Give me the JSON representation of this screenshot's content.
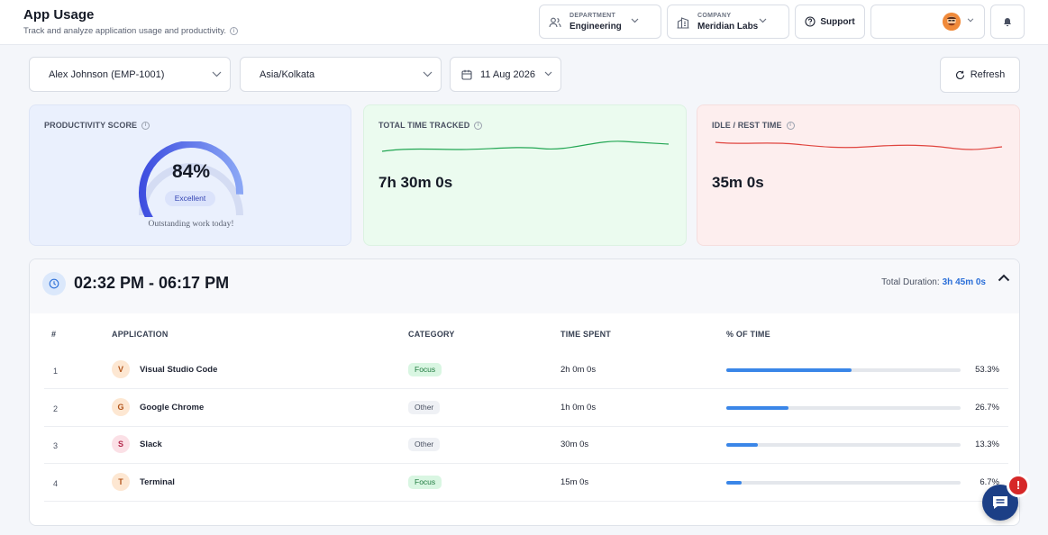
{
  "header": {
    "title": "App Usage",
    "subtitle": "Track and analyze application usage and productivity.",
    "department": {
      "label": "DEPARTMENT",
      "value": "Engineering"
    },
    "company": {
      "label": "COMPANY",
      "value": "Meridian Labs"
    },
    "support_label": "Support"
  },
  "filters": {
    "employee": "Alex Johnson (EMP-1001)",
    "timezone": "Asia/Kolkata",
    "date": "11 Aug 2026",
    "refresh_label": "Refresh"
  },
  "cards": {
    "productivity": {
      "title": "PRODUCTIVITY SCORE",
      "score_text": "84%",
      "score": 84,
      "badge": "Excellent",
      "note": "Outstanding work today!"
    },
    "tracked": {
      "title": "TOTAL TIME TRACKED",
      "value": "7h 30m 0s",
      "color": "#22a653"
    },
    "idle": {
      "title": "IDLE / REST TIME",
      "value": "35m 0s",
      "color": "#e0453f"
    }
  },
  "session": {
    "range": "02:32 PM - 06:17 PM",
    "duration_label": "Total Duration:",
    "duration_value": "3h 45m 0s",
    "columns": [
      "#",
      "APPLICATION",
      "CATEGORY",
      "TIME SPENT",
      "% OF TIME"
    ],
    "rows": [
      {
        "n": "1",
        "initial": "V",
        "name": "Visual Studio Code",
        "category": "Focus",
        "time": "2h 0m 0s",
        "pct_text": "53.3%",
        "pct": 53.3
      },
      {
        "n": "2",
        "initial": "G",
        "name": "Google Chrome",
        "category": "Other",
        "time": "1h 0m 0s",
        "pct_text": "26.7%",
        "pct": 26.7
      },
      {
        "n": "3",
        "initial": "S",
        "name": "Slack",
        "category": "Other",
        "time": "30m 0s",
        "pct_text": "13.3%",
        "pct": 13.3
      },
      {
        "n": "4",
        "initial": "T",
        "name": "Terminal",
        "category": "Focus",
        "time": "15m 0s",
        "pct_text": "6.7%",
        "pct": 6.7
      }
    ]
  },
  "colors": {
    "accent": "#2a6ed8",
    "focus_badge": "#d9f6e2",
    "alert": "#d62828"
  }
}
